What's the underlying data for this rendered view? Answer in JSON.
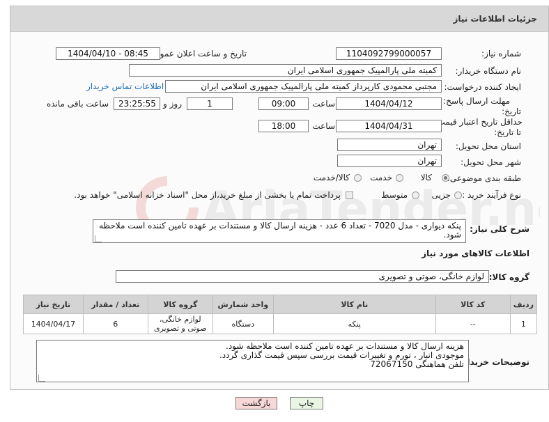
{
  "header": {
    "title": "جزئیات اطلاعات نیاز"
  },
  "form": {
    "need_number_label": "شماره نیاز:",
    "need_number": "1104092799000057",
    "announce_datetime_label": "تاریخ و ساعت اعلان عمومی:",
    "announce_datetime": "1404/04/10 - 08:45",
    "buyer_org_label": "نام دستگاه خریدار:",
    "buyer_org": "کمیته ملی پارالمپیک جمهوری اسلامی ایران",
    "requester_label": "ایجاد کننده درخواست:",
    "requester": "مجتبی محمودی کارپرداز کمیته ملی پارالمپیک جمهوری اسلامی ایران",
    "contact_link": "اطلاعات تماس خریدار",
    "reply_deadline_label_1": "مهلت ارسال پاسخ: تا",
    "reply_deadline_label_2": "تاریخ:",
    "reply_date": "1404/04/12",
    "time_label": "ساعت",
    "reply_time": "09:00",
    "days_value": "1",
    "days_label": "روز و",
    "remaining_time": "23:25:55",
    "remaining_label": "ساعت باقی مانده",
    "price_validity_label_1": "حداقل تاریخ اعتبار قیمت:",
    "price_validity_label_2": "تا تاریخ:",
    "validity_date": "1404/04/31",
    "validity_time": "18:00",
    "delivery_province_label": "استان محل تحویل:",
    "delivery_province": "تهران",
    "delivery_city_label": "شهر محل تحویل:",
    "delivery_city": "تهران",
    "category_label": "طبقه بندی موضوعی:",
    "category_options": [
      "کالا",
      "خدمت",
      "کالا/خدمت"
    ],
    "purchase_type_label": "نوع فرآیند خرید :",
    "purchase_options": [
      "جزیی",
      "متوسط"
    ],
    "payment_note": "پرداخت تمام یا بخشی از مبلغ خرید،از محل \"اسناد خزانه اسلامی\" خواهد بود.",
    "description_label": "شرح کلی نیاز:",
    "description": "پنکه دیواری - مدل 7020 - تعداد 6 عدد - هزینه ارسال کالا و مستندات بر عهده تامین کننده است ملاحظه شود."
  },
  "goods": {
    "section_title": "اطلاعات کالاهای مورد نیاز",
    "group_label": "گروه کالا:",
    "group_value": "لوازم خانگی، صوتی و تصویری",
    "columns": [
      "ردیف",
      "کد کالا",
      "نام کالا",
      "واحد شمارش",
      "گروه کالا",
      "تعداد / مقدار",
      "تاریخ نیاز"
    ],
    "rows": [
      {
        "row": "1",
        "code": "--",
        "name": "پنکه",
        "unit": "دستگاه",
        "group": "لوازم خانگی، صوتی و تصویری",
        "qty": "6",
        "date": "1404/04/17"
      }
    ]
  },
  "buyer_notes": {
    "label": "توضیحات خریدار:",
    "text": "هزینه ارسال کالا و مستندات بر عهده تامین کننده است ملاحظه شود.\nموجودی انبار ، تورم و تغییرات قیمت بررسی سپس قیمت گذاری گردد.\nتلفن هماهنگی 72067150"
  },
  "buttons": {
    "print": "چاپ",
    "back": "بازگشت"
  },
  "watermark": {
    "text": "AriaTender.neT"
  },
  "colors": {
    "link": "#1a6ebd",
    "back_button_bg": "#f8d7d7",
    "print_button_bg": "#e9f6e4"
  }
}
